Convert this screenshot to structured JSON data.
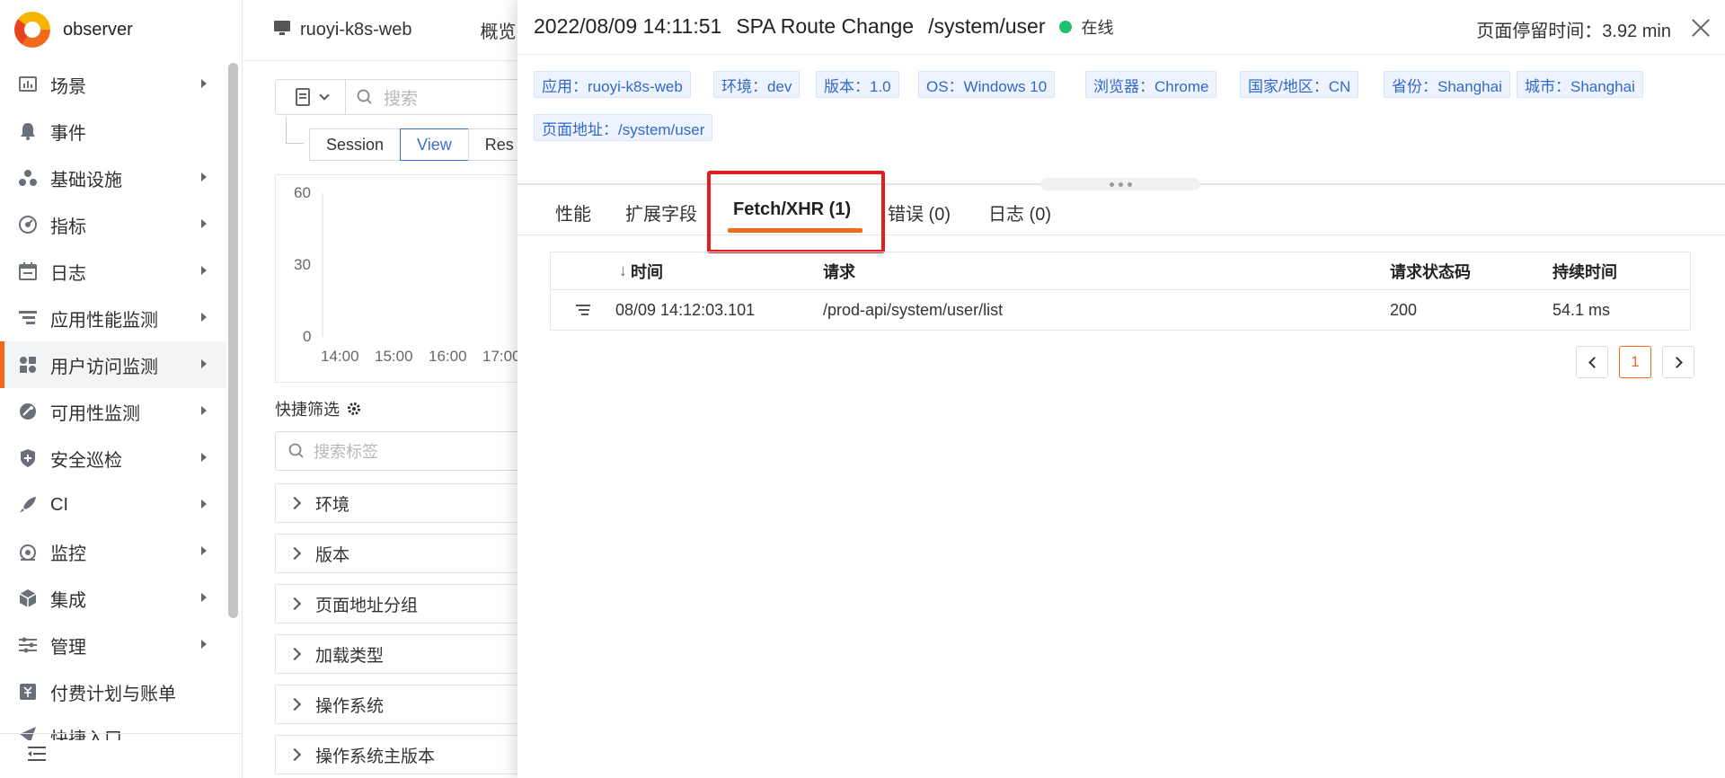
{
  "brand": {
    "name": "observer"
  },
  "sidebar": {
    "items": [
      {
        "label": "场景",
        "icon": "dashboard-icon",
        "arrow": true
      },
      {
        "label": "事件",
        "icon": "bell-icon",
        "arrow": false
      },
      {
        "label": "基础设施",
        "icon": "infrastructure-icon",
        "arrow": true
      },
      {
        "label": "指标",
        "icon": "metric-icon",
        "arrow": true
      },
      {
        "label": "日志",
        "icon": "log-icon",
        "arrow": true
      },
      {
        "label": "应用性能监测",
        "icon": "apm-icon",
        "arrow": true
      },
      {
        "label": "用户访问监测",
        "icon": "rum-icon",
        "arrow": true,
        "active": true
      },
      {
        "label": "可用性监测",
        "icon": "dialtesting-icon",
        "arrow": true
      },
      {
        "label": "安全巡检",
        "icon": "security-icon",
        "arrow": true
      },
      {
        "label": "CI",
        "icon": "rocket-icon",
        "arrow": true
      },
      {
        "label": "监控",
        "icon": "monitor-icon",
        "arrow": true
      },
      {
        "label": "集成",
        "icon": "integration-icon",
        "arrow": true
      },
      {
        "label": "管理",
        "icon": "settings-icon",
        "arrow": true
      },
      {
        "label": "付费计划与账单",
        "icon": "billing-icon",
        "arrow": false
      },
      {
        "label": "快捷入口",
        "icon": "shortcut-icon",
        "arrow": false
      }
    ]
  },
  "background_page": {
    "app_name": "ruoyi-k8s-web",
    "overview_tab": "概览",
    "search_placeholder": "搜索",
    "tabs": [
      "Session",
      "View",
      "Res"
    ],
    "active_tab": "View",
    "chart_data": {
      "type": "bar",
      "y_ticks": [
        "60",
        "30",
        "0"
      ],
      "x_ticks": [
        "14:00",
        "15:00",
        "16:00",
        "17:00"
      ],
      "ylim": [
        0,
        60
      ]
    },
    "quick_filter_label": "快捷筛选",
    "tag_search_placeholder": "搜索标签",
    "facets": [
      "环境",
      "版本",
      "页面地址分组",
      "加载类型",
      "操作系统",
      "操作系统主版本"
    ]
  },
  "drawer": {
    "timestamp": "2022/08/09 14:11:51",
    "event_type": "SPA Route Change",
    "path": "/system/user",
    "status": "在线",
    "status_color": "#1fbf6f",
    "dwell_time": "页面停留时间：3.92 min",
    "tags": [
      "应用：ruoyi-k8s-web",
      "环境：dev",
      "版本：1.0",
      "OS：Windows 10",
      "浏览器：Chrome",
      "国家/地区：CN",
      "省份：Shanghai",
      "城市：Shanghai",
      "页面地址：/system/user"
    ],
    "tabs": [
      "性能",
      "扩展字段",
      "Fetch/XHR (1)",
      "错误 (0)",
      "日志 (0)"
    ],
    "active_tab": "Fetch/XHR (1)",
    "table": {
      "columns": [
        "时间",
        "请求",
        "请求状态码",
        "持续时间"
      ],
      "sort_indicator": "↓",
      "rows": [
        {
          "time": "08/09 14:12:03.101",
          "request": "/prod-api/system/user/list",
          "status_code": "200",
          "duration": "54.1 ms"
        }
      ]
    },
    "pagination": {
      "current": "1"
    }
  },
  "colors": {
    "accent": "#f06a1c",
    "link": "#3467c8",
    "highlight": "#e41d1d"
  }
}
